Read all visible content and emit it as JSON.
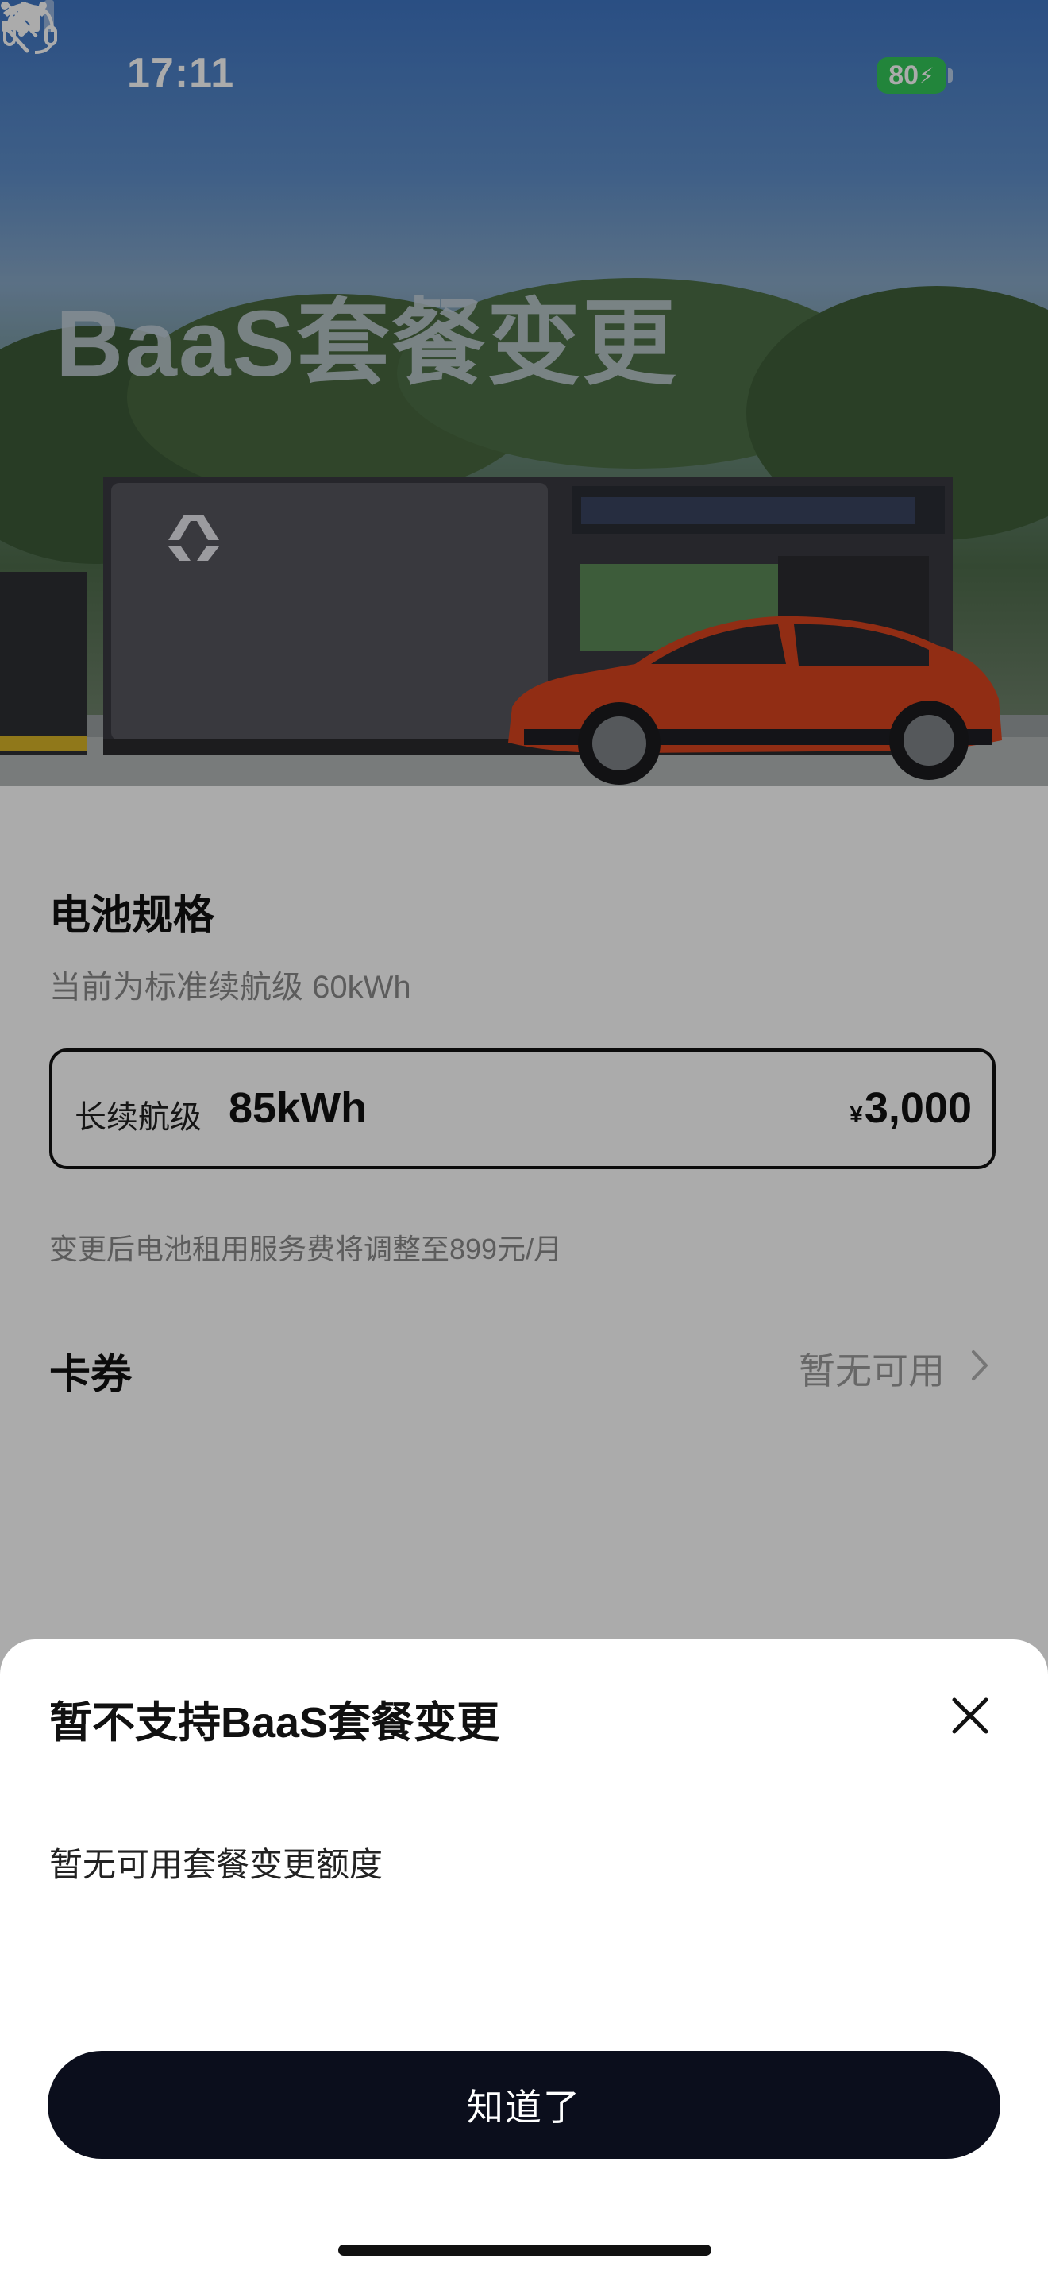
{
  "status_bar": {
    "time": "17:11",
    "battery": "80"
  },
  "header": {
    "title": "BaaS套餐变更"
  },
  "battery_spec": {
    "title": "电池规格",
    "current": "当前为标准续航级 60kWh",
    "option": {
      "label": "长续航级",
      "capacity": "85kWh",
      "currency": "¥",
      "price": "3,000"
    },
    "fee_note": "变更后电池租用服务费将调整至899元/月"
  },
  "coupon": {
    "title": "卡券",
    "value": "暂无可用"
  },
  "sheet": {
    "title": "暂不支持BaaS套餐变更",
    "message": "暂无可用套餐变更额度",
    "confirm_label": "知道了"
  },
  "colors": {
    "accent": "#0b0e1c",
    "battery": "#34c759",
    "car": "#d8431f"
  },
  "icons": [
    "back-icon",
    "headset-icon",
    "more-icon",
    "close-icon",
    "chevron-right-icon",
    "bell-off-icon",
    "signal-icon",
    "wifi-icon",
    "nio-logo"
  ]
}
